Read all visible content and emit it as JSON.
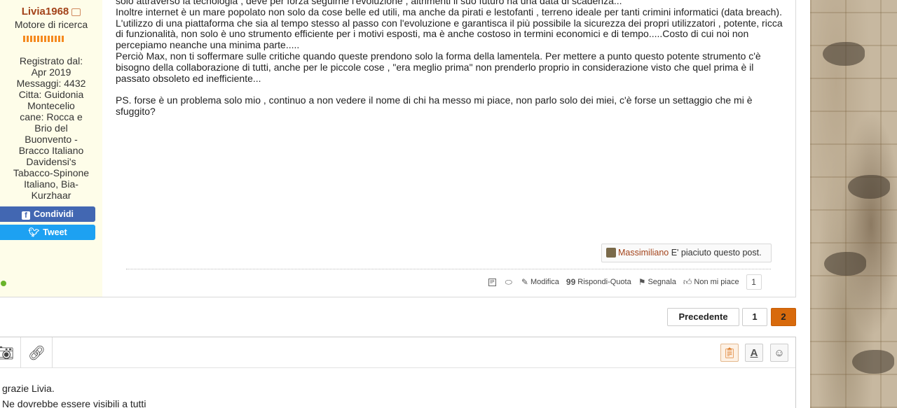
{
  "user": {
    "name": "Livia1968",
    "rank": "Motore di ricerca",
    "info_lines": [
      "Registrato dal:",
      "Apr 2019",
      "Messaggi: 4432",
      "Citta: Guidonia",
      "Montecelio",
      "cane: Rocca e",
      "Brio del",
      "Buonvento -",
      "Bracco Italiano",
      "Davidensi's",
      "Tabacco-Spinone",
      "Italiano, Bia-",
      "Kurzhaar"
    ],
    "share_facebook": "Condividi",
    "share_twitter": "Tweet"
  },
  "post": {
    "paragraphs": [
      "solo attraverso la tecnologia , deve per forza seguirne l'evoluzione , altrimenti il suo futuro ha una data di scadenza...",
      "Inoltre internet è un mare popolato non solo da cose belle ed utili, ma anche da pirati e lestofanti , terreno ideale per tanti crimini informatici (data breach).",
      "L'utilizzo di una piattaforma che sia al tempo stesso al passo con l'evoluzione e garantisca il più possibile la sicurezza dei propri utilizzatori , potente, ricca di funzionalità, non solo è uno strumento efficiente per i motivi esposti, ma è anche costoso in termini economici e di tempo.....Costo di cui noi non percepiamo neanche una minima parte.....",
      "Perciò Max, non ti soffermare sulle critiche quando queste prendono solo la forma della lamentela. Per mettere a punto questo potente strumento c'è bisogno della collaborazione di tutti, anche per le piccole cose , \"era meglio prima\" non prenderlo proprio in considerazione visto che quel prima è il passato obsoleto ed inefficiente...",
      "",
      "PS. forse è un problema solo mio , continuo a non vedere il nome di chi ha messo mi piace, non parlo solo dei miei, c'è forse un settaggio che mi è sfuggito?"
    ],
    "like": {
      "liker": "Massimiliano",
      "text": " E' piaciuto questo post."
    },
    "actions": {
      "ip": "IP",
      "modifica": "Modifica",
      "rispondi_quota": "Rispondi-Quota",
      "segnala": "Segnala",
      "non_mi_piace": "Non mi piace",
      "count": "1"
    }
  },
  "pagination": {
    "prev": "Precedente",
    "page1": "1",
    "page2": "2",
    "current": 2
  },
  "editor": {
    "lines": [
      "grazie Livia.",
      "Ne dovrebbe essere visibili a tutti"
    ]
  },
  "colors": {
    "accent": "#d86a0c",
    "username": "#a3431a",
    "user_bg": "#fefde9",
    "facebook": "#4267b2",
    "twitter": "#1da1f2"
  }
}
